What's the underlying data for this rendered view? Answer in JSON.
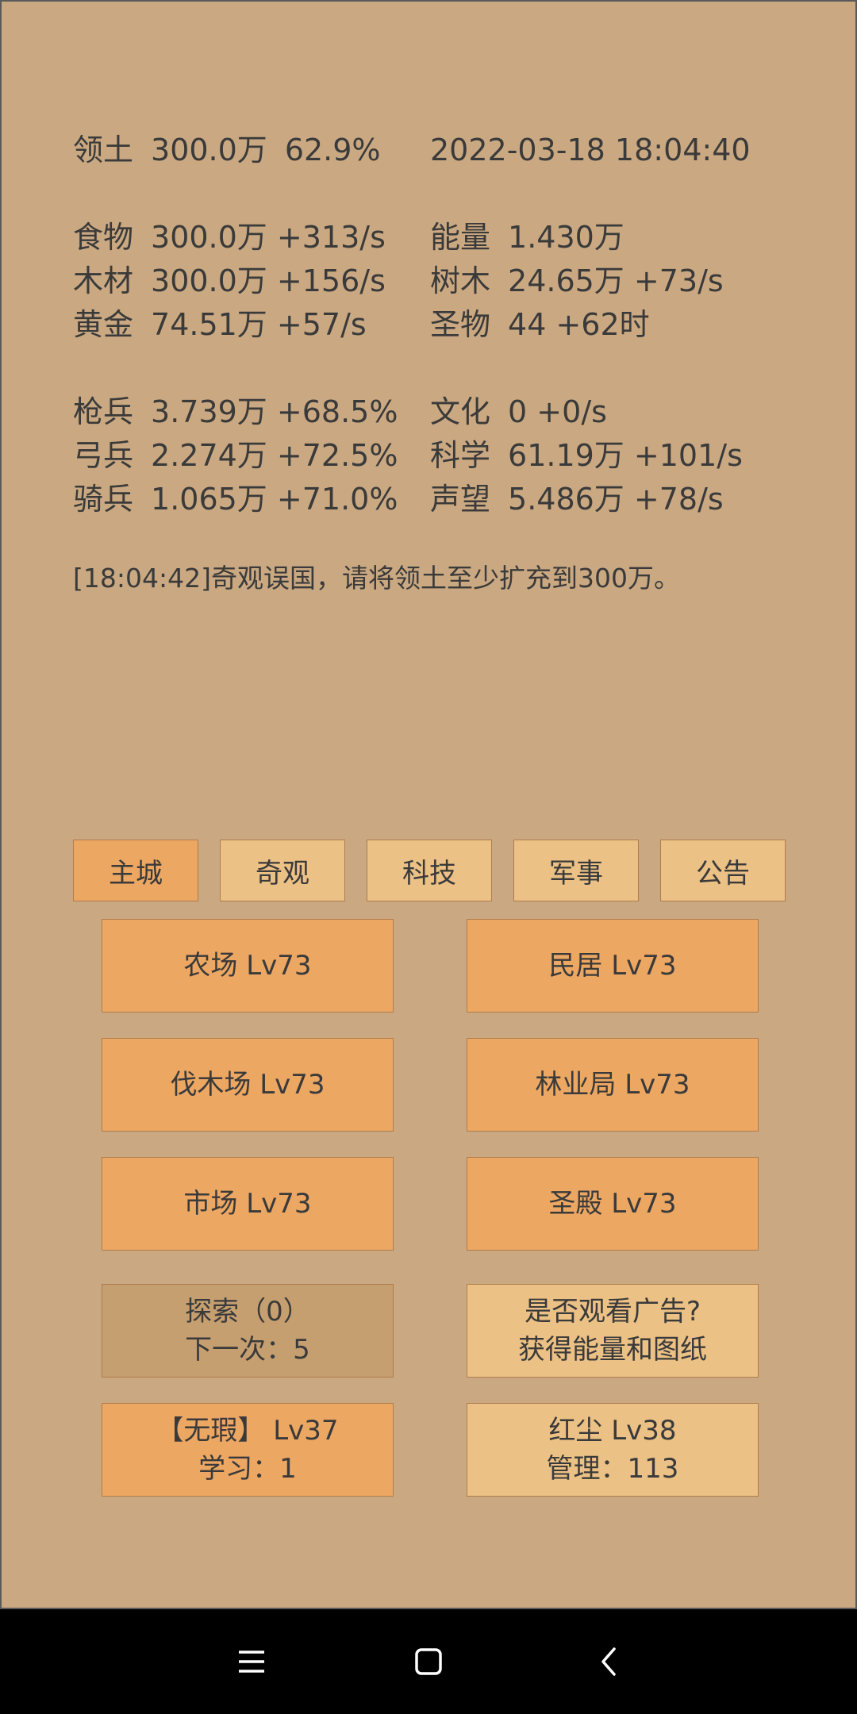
{
  "header": {
    "territory": {
      "label": "领土",
      "value": "300.0万",
      "percent": "62.9%"
    },
    "datetime": "2022-03-18 18:04:40"
  },
  "resources_left": [
    {
      "label": "食物",
      "value": "300.0万",
      "rate": "+313/s"
    },
    {
      "label": "木材",
      "value": "300.0万",
      "rate": "+156/s"
    },
    {
      "label": "黄金",
      "value": "74.51万",
      "rate": "+57/s"
    }
  ],
  "resources_right": [
    {
      "label": "能量",
      "value": "1.430万",
      "rate": ""
    },
    {
      "label": "树木",
      "value": "24.65万",
      "rate": "+73/s"
    },
    {
      "label": "圣物",
      "value": "44",
      "rate": "+62时"
    }
  ],
  "military": [
    {
      "label": "枪兵",
      "value": "3.739万",
      "rate": "+68.5%"
    },
    {
      "label": "弓兵",
      "value": "2.274万",
      "rate": "+72.5%"
    },
    {
      "label": "骑兵",
      "value": "1.065万",
      "rate": "+71.0%"
    }
  ],
  "culture": [
    {
      "label": "文化",
      "value": "0",
      "rate": "+0/s"
    },
    {
      "label": "科学",
      "value": "61.19万",
      "rate": "+101/s"
    },
    {
      "label": "声望",
      "value": "5.486万",
      "rate": "+78/s"
    }
  ],
  "log": "[18:04:42]奇观误国，请将领土至少扩充到300万。",
  "tabs": [
    "主城",
    "奇观",
    "科技",
    "军事",
    "公告"
  ],
  "buildings": [
    "农场 Lv73",
    "民居 Lv73",
    "伐木场 Lv73",
    "林业局 Lv73",
    "市场 Lv73",
    "圣殿 Lv73"
  ],
  "explore": {
    "line1": "探索（0）",
    "line2": "下一次：5"
  },
  "ad": {
    "line1": "是否观看广告?",
    "line2": "获得能量和图纸"
  },
  "hero1": {
    "line1": "【无瑕】 Lv37",
    "line2": "学习：1"
  },
  "hero2": {
    "line1": "红尘 Lv38",
    "line2": "管理：113"
  },
  "colors": {
    "background": "#caa982",
    "button": "#eca763",
    "button_light": "#ecc185",
    "button_muted": "#c69f70"
  },
  "navbar_icons": [
    "menu-icon",
    "home-icon",
    "back-icon"
  ]
}
